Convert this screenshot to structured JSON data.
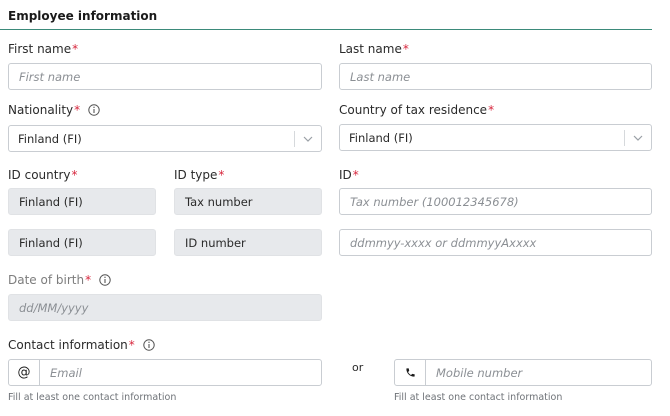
{
  "section": {
    "title": "Employee information"
  },
  "first_name": {
    "label": "First name",
    "placeholder": "First name"
  },
  "last_name": {
    "label": "Last name",
    "placeholder": "Last name"
  },
  "nationality": {
    "label": "Nationality",
    "value": "Finland (FI)"
  },
  "tax_residence": {
    "label": "Country of tax residence",
    "value": "Finland (FI)"
  },
  "id_country": {
    "label": "ID country",
    "rows": [
      "Finland (FI)",
      "Finland (FI)"
    ]
  },
  "id_type": {
    "label": "ID type",
    "rows": [
      "Tax number",
      "ID number"
    ]
  },
  "id": {
    "label": "ID",
    "rows": [
      "Tax number (100012345678)",
      "ddmmyy-xxxx or ddmmyyAxxxx"
    ]
  },
  "dob": {
    "label": "Date of birth",
    "placeholder": "dd/MM/yyyy"
  },
  "contact": {
    "label": "Contact information",
    "email_prefix": "@",
    "email_placeholder": "Email",
    "or_text": "or",
    "mobile_placeholder": "Mobile number",
    "help_email": "Fill at least one contact information",
    "help_mobile": "Fill at least one contact information"
  },
  "required_mark": "*",
  "colors": {
    "required": "#d7263d",
    "accent_rule": "#3b8a7a",
    "disabled_bg": "#e7e9ec"
  },
  "icons": {
    "info": "info-icon",
    "chevron": "chevron-down-icon",
    "phone": "phone-icon"
  }
}
